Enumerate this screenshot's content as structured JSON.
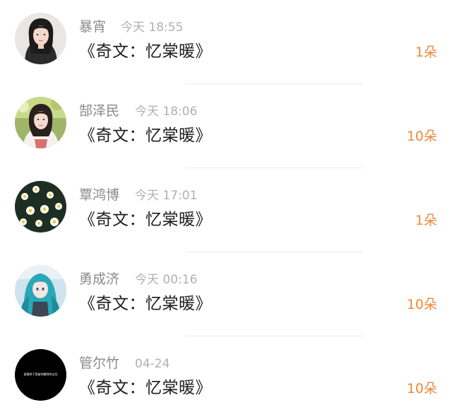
{
  "items": [
    {
      "name": "暴宵",
      "time": "今天 18:55",
      "title": "《奇文：忆棠暖》",
      "count": "1朵",
      "avatar": "girl-portrait-avatar"
    },
    {
      "name": "郜泽民",
      "time": "今天 18:06",
      "title": "《奇文：忆棠暖》",
      "count": "10朵",
      "avatar": "girl-outdoor-avatar"
    },
    {
      "name": "覃鸿博",
      "time": "今天 17:01",
      "title": "《奇文：忆棠暖》",
      "count": "1朵",
      "avatar": "daisy-flowers-avatar"
    },
    {
      "name": "勇成济",
      "time": "今天 00:16",
      "title": "《奇文：忆棠暖》",
      "count": "10朵",
      "avatar": "anime-girl-avatar"
    },
    {
      "name": "管尔竹",
      "time": "04-24",
      "title": "《奇文：忆棠暖》",
      "count": "10朵",
      "avatar": "black-text-avatar",
      "avatar_text": "爱情终于是被你删除的过往"
    }
  ],
  "colors": {
    "name": "#8a8a8a",
    "time": "#b0b0b0",
    "title": "#1e1e1e",
    "count": "#f0883a",
    "divider": "#ececec"
  }
}
